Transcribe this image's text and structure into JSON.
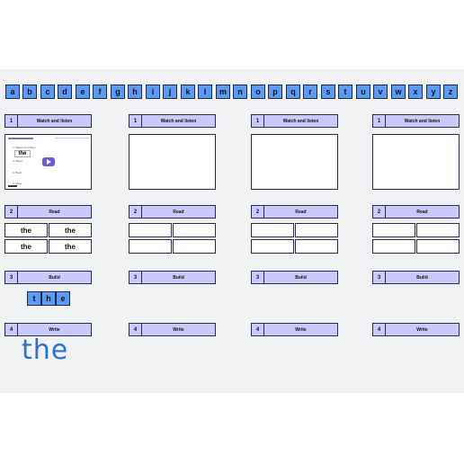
{
  "alphabet": [
    "a",
    "b",
    "c",
    "d",
    "e",
    "f",
    "g",
    "h",
    "i",
    "j",
    "k",
    "l",
    "m",
    "n",
    "o",
    "p",
    "q",
    "r",
    "s",
    "t",
    "u",
    "v",
    "w",
    "x",
    "y",
    "z"
  ],
  "sections": {
    "watch": {
      "num": "1",
      "label": "Watch and listen"
    },
    "read": {
      "num": "2",
      "label": "Read"
    },
    "build": {
      "num": "3",
      "label": "Build"
    },
    "write": {
      "num": "4",
      "label": "Write"
    }
  },
  "video": {
    "slide_word": "the",
    "slide_items": [
      "1. Watch and listen",
      "2. Read",
      "3. Build",
      "4. Write"
    ],
    "play_icon": "play-icon"
  },
  "read_words": [
    "the",
    "the",
    "the",
    "the"
  ],
  "build_letters": [
    "t",
    "h",
    "e"
  ],
  "written_word": "the",
  "colors": {
    "board": "#f1f2f4",
    "tile": "#5b9bf5",
    "header": "#c9c9fb",
    "ink": "#2f6fd6",
    "play": "#6a5ae0"
  }
}
